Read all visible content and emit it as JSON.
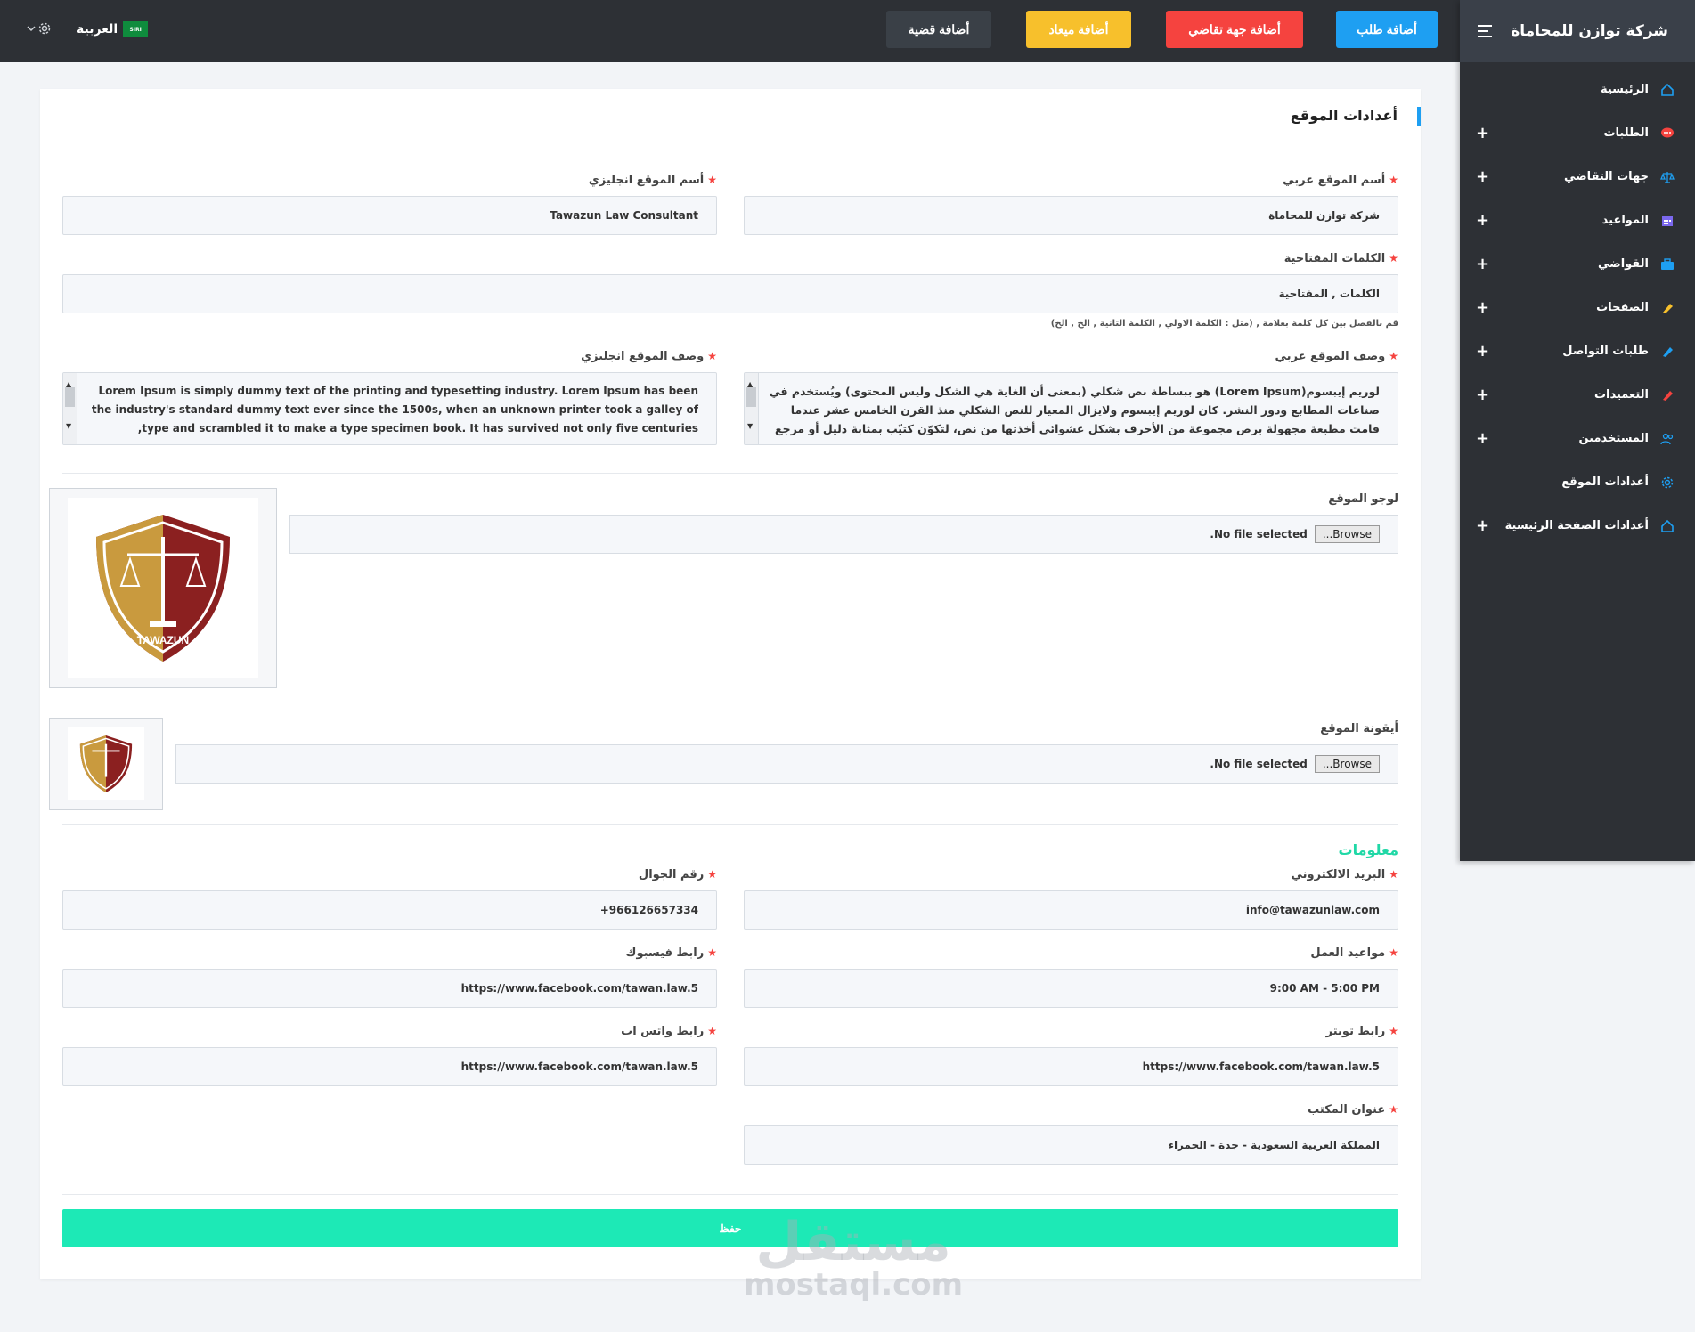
{
  "topbar": {
    "buttons": {
      "add_request": "أضافة طلب",
      "add_party": "أضافة جهة تقاضي",
      "add_appointment": "أضافة ميعاد",
      "add_case": "أضافة قضية"
    },
    "language": "العربية",
    "flag_text": "SIRI",
    "colors": {
      "blue": "#1e9ff2",
      "red": "#f5433f",
      "yellow": "#f7c02c",
      "dark": "#3a4047"
    }
  },
  "sidebar": {
    "title": "شركة توازن للمحاماة",
    "items": [
      {
        "label": "الرئيسية",
        "icon": "home-icon",
        "expandable": false
      },
      {
        "label": "الطلبات",
        "icon": "chat-icon",
        "expandable": true
      },
      {
        "label": "جهات التقاضي",
        "icon": "scale-icon",
        "expandable": true
      },
      {
        "label": "المواعيد",
        "icon": "calendar-icon",
        "expandable": true
      },
      {
        "label": "القواضي",
        "icon": "briefcase-icon",
        "expandable": true
      },
      {
        "label": "الصفحات",
        "icon": "pencil-icon",
        "expandable": true
      },
      {
        "label": "طلبات التواصل",
        "icon": "pen-icon",
        "expandable": true
      },
      {
        "label": "التعميدات",
        "icon": "tag-icon",
        "expandable": true
      },
      {
        "label": "المستخدمين",
        "icon": "users-icon",
        "expandable": true
      },
      {
        "label": "أعدادات الموقع",
        "icon": "gear-icon",
        "expandable": false
      },
      {
        "label": "أعدادات الصفحة الرئيسية",
        "icon": "home-icon",
        "expandable": true
      }
    ]
  },
  "page": {
    "title": "أعدادات الموقع",
    "fields": {
      "site_name_ar": {
        "label": "أسم الموقع عربي",
        "value": "شركة توازن للمحاماة"
      },
      "site_name_en": {
        "label": "أسم الموقع انجليزي",
        "value": "Tawazun Law Consultant"
      },
      "keywords": {
        "label": "الكلمات المفتاحية",
        "value": "الكلمات , المفتاحية",
        "hint": "قم بالفصل بين كل كلمة بعلامة , (مثل : الكلمة الاولي , الكلمة الثانية , الخ , الخ)"
      },
      "desc_ar": {
        "label": "وصف الموقع عربي",
        "value": "لوريم إيبسوم(Lorem Ipsum) هو ببساطة نص شكلي (بمعنى أن الغاية هي الشكل وليس المحتوى) ويُستخدم في صناعات المطابع ودور النشر. كان لوريم إيبسوم ولايزال المعيار للنص الشكلي منذ القرن الخامس عشر عندما قامت مطبعة مجهولة برص مجموعة من الأحرف بشكل عشوائي أخذتها من نص، لتكوّن كتيّب بمثابة دليل أو مرجع"
      },
      "desc_en": {
        "label": "وصف الموقع انجليزي",
        "value": "Lorem Ipsum is simply dummy text of the printing and typesetting industry. Lorem Ipsum has been the industry's standard dummy text ever since the 1500s, when an unknown printer took a galley of type and scrambled it to make a type specimen book. It has survived not only five centuries,"
      },
      "logo": {
        "label": "لوجو الموقع",
        "file_status": "No file selected.",
        "browse": "Browse..."
      },
      "favicon": {
        "label": "أيقونة الموقع",
        "file_status": "No file selected.",
        "browse": "Browse..."
      }
    },
    "logo_text": "TAWAZUN",
    "info_section": {
      "title": "معلومات",
      "email": {
        "label": "البريد الالكتروني",
        "value": "info@tawazunlaw.com"
      },
      "phone": {
        "label": "رقم الجوال",
        "value": "+966126657334"
      },
      "hours": {
        "label": "مواعيد العمل",
        "value": "9:00 AM - 5:00 PM"
      },
      "facebook": {
        "label": "رابط فيسبوك",
        "value": "https://www.facebook.com/tawan.law.5"
      },
      "twitter": {
        "label": "رابط تويتر",
        "value": "https://www.facebook.com/tawan.law.5"
      },
      "whatsapp": {
        "label": "رابط واتس اب",
        "value": "https://www.facebook.com/tawan.law.5"
      },
      "address": {
        "label": "عنوان المكتب",
        "value": "المملكة العربية السعودية - جدة - الحمراء"
      }
    },
    "save_label": "حفظ",
    "accent_color": "#1de9b6"
  },
  "watermark": {
    "arabic": "مستقل",
    "latin": "mostaql.com"
  }
}
